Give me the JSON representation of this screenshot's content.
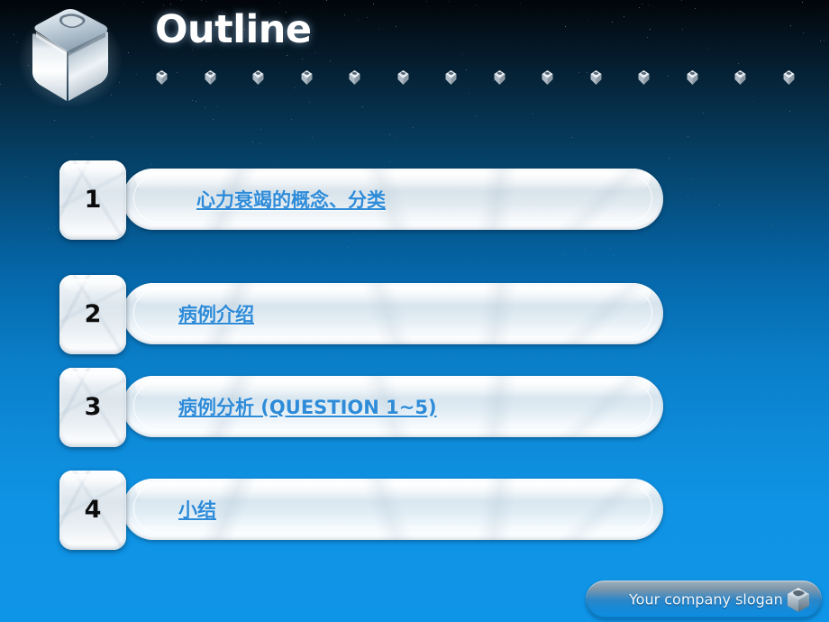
{
  "slide": {
    "title": "Outline",
    "background": {
      "top_color": "#020509",
      "bottom_color": "#0f95e8"
    },
    "accent_color": "#2e8bd8"
  },
  "header": {
    "logo_icon": "chrome-cube-icon",
    "divider_cube_count": 14,
    "divider_cube_icon": "mini-cube-icon"
  },
  "outline": {
    "items": [
      {
        "number": "1",
        "label": "心力衰竭的概念、分类 "
      },
      {
        "number": "2",
        "label": "病例介绍 "
      },
      {
        "number": "3",
        "label": "病例分析 (QUESTION 1~5)"
      },
      {
        "number": "4",
        "label": "小结 "
      }
    ]
  },
  "footer": {
    "slogan": "Your company slogan",
    "icon": "cube-icon"
  }
}
